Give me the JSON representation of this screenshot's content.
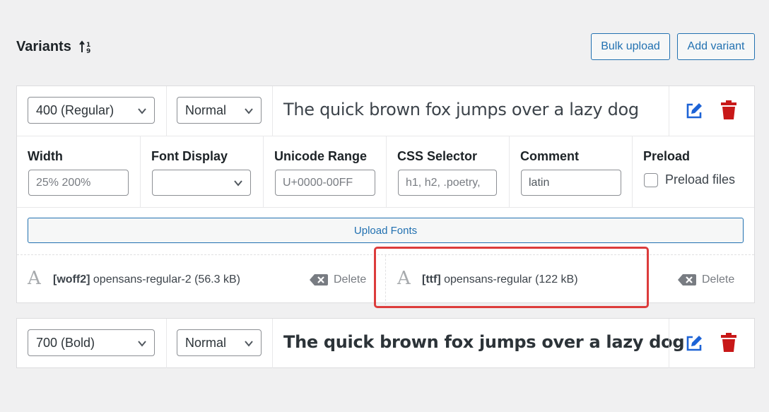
{
  "header": {
    "title": "Variants",
    "bulk_upload_label": "Bulk upload",
    "add_variant_label": "Add variant"
  },
  "variants": [
    {
      "weight": "400 (Regular)",
      "style": "Normal",
      "preview": "The quick brown fox jumps over a lazy dog",
      "fields": {
        "width_label": "Width",
        "width_placeholder": "25% 200%",
        "font_display_label": "Font Display",
        "font_display_value": "",
        "unicode_range_label": "Unicode Range",
        "unicode_range_placeholder": "U+0000-00FF",
        "css_selector_label": "CSS Selector",
        "css_selector_placeholder": "h1, h2, .poetry,",
        "comment_label": "Comment",
        "comment_value": "latin",
        "preload_label": "Preload",
        "preload_files_label": "Preload files"
      },
      "upload_label": "Upload Fonts",
      "files": [
        {
          "format": "[woff2]",
          "name": "opensans-regular-2 (56.3 kB)",
          "delete_label": "Delete"
        },
        {
          "format": "[ttf]",
          "name": "opensans-regular (122 kB)",
          "delete_label": "Delete"
        }
      ]
    },
    {
      "weight": "700 (Bold)",
      "style": "Normal",
      "preview": "The quick brown fox jumps over a lazy dog"
    }
  ],
  "colors": {
    "accent": "#2271b1",
    "edit_icon": "#1d63d6",
    "delete_icon": "#c81818",
    "highlight": "#dc3c3c"
  },
  "icons": {
    "sort": "sort-arrows-icon",
    "edit": "edit-icon",
    "trash": "trash-icon",
    "font_file": "font-file-icon",
    "delete": "backspace-icon"
  }
}
